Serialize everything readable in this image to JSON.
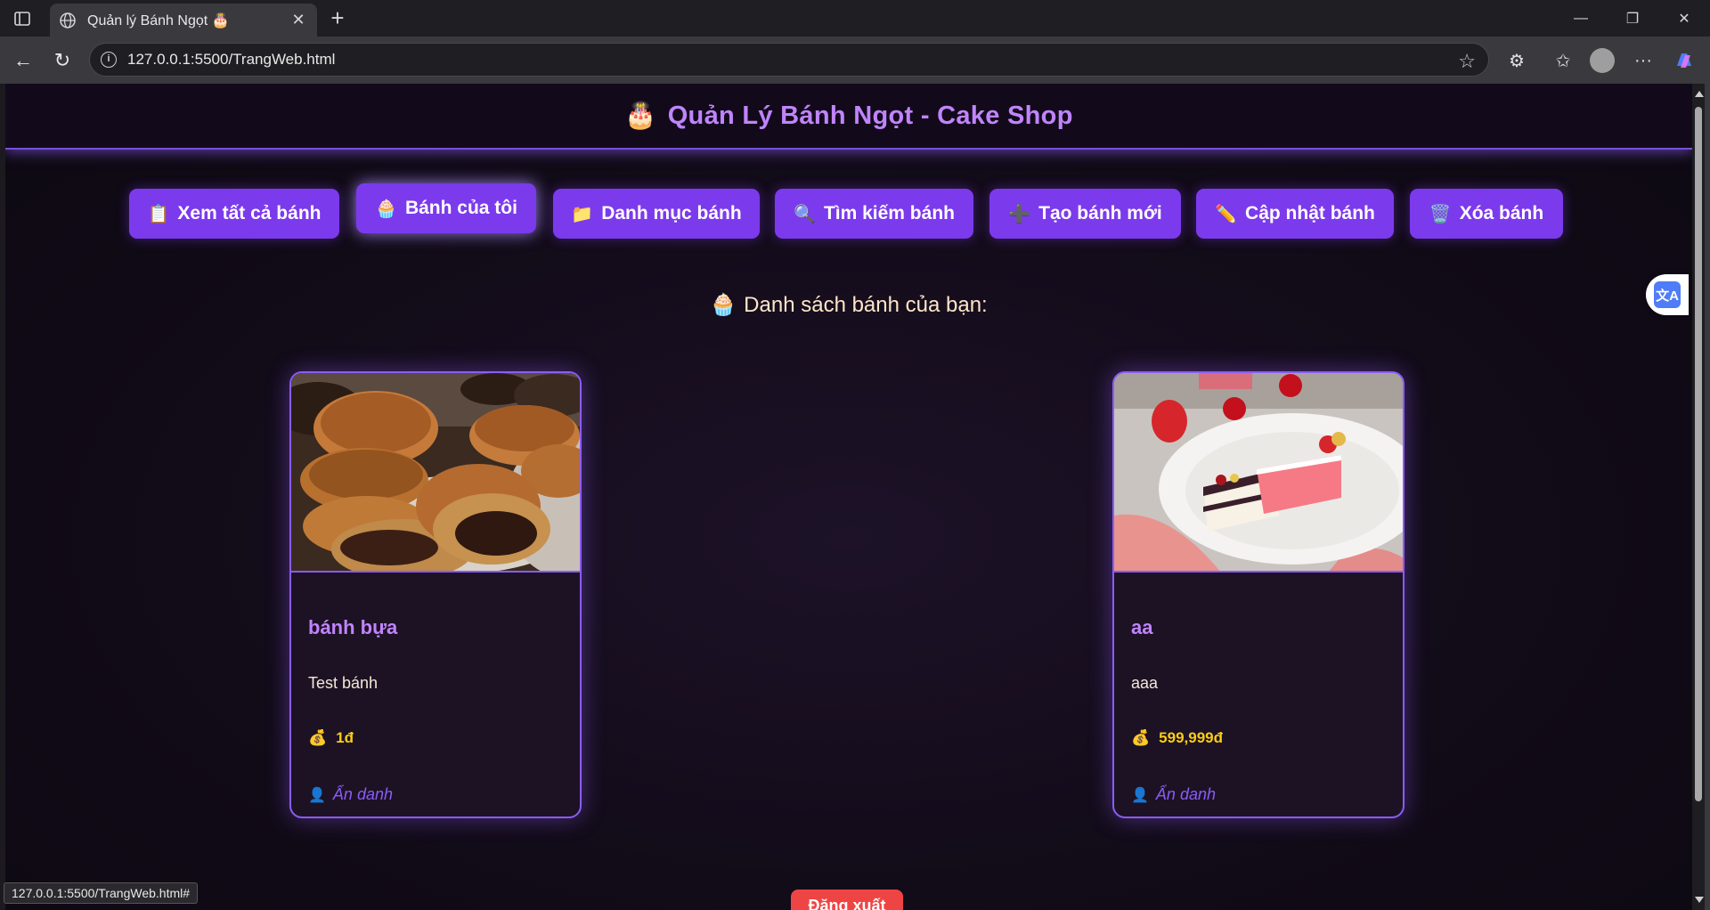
{
  "browser": {
    "tab_title": "Quản lý Bánh Ngọt 🎂",
    "url": "127.0.0.1:5500/TrangWeb.html",
    "status_url": "127.0.0.1:5500/TrangWeb.html#"
  },
  "header": {
    "emoji": "🎂",
    "title": "Quản Lý Bánh Ngọt - Cake Shop"
  },
  "menu": [
    {
      "emoji": "📋",
      "label": "Xem tất cả bánh"
    },
    {
      "emoji": "🧁",
      "label": "Bánh của tôi"
    },
    {
      "emoji": "📁",
      "label": "Danh mục bánh"
    },
    {
      "emoji": "🔍",
      "label": "Tìm kiếm bánh"
    },
    {
      "emoji": "➕",
      "label": "Tạo bánh mới"
    },
    {
      "emoji": "✏️",
      "label": "Cập nhật bánh"
    },
    {
      "emoji": "🗑️",
      "label": "Xóa bánh"
    }
  ],
  "section": {
    "emoji": "🧁",
    "title": "Danh sách bánh của bạn:"
  },
  "cakes": [
    {
      "name": "bánh bựa",
      "description": "Test bánh",
      "price_icon": "💰",
      "price": "1đ",
      "author_icon": "👤",
      "author": "Ẩn danh",
      "image": "dorayaki-pancakes-photo"
    },
    {
      "name": "aa",
      "description": "aaa",
      "price_icon": "💰",
      "price": "599,999đ",
      "author_icon": "👤",
      "author": "Ẩn danh",
      "image": "cake-slices-plate-photo"
    }
  ],
  "logout": {
    "label": "Đăng xuất"
  },
  "translate": {
    "icon": "translate-icon",
    "glyph": "文A"
  },
  "colors": {
    "accent": "#7c3aed",
    "title": "#c084fc",
    "price": "#facc15",
    "logout": "#ef4444"
  }
}
